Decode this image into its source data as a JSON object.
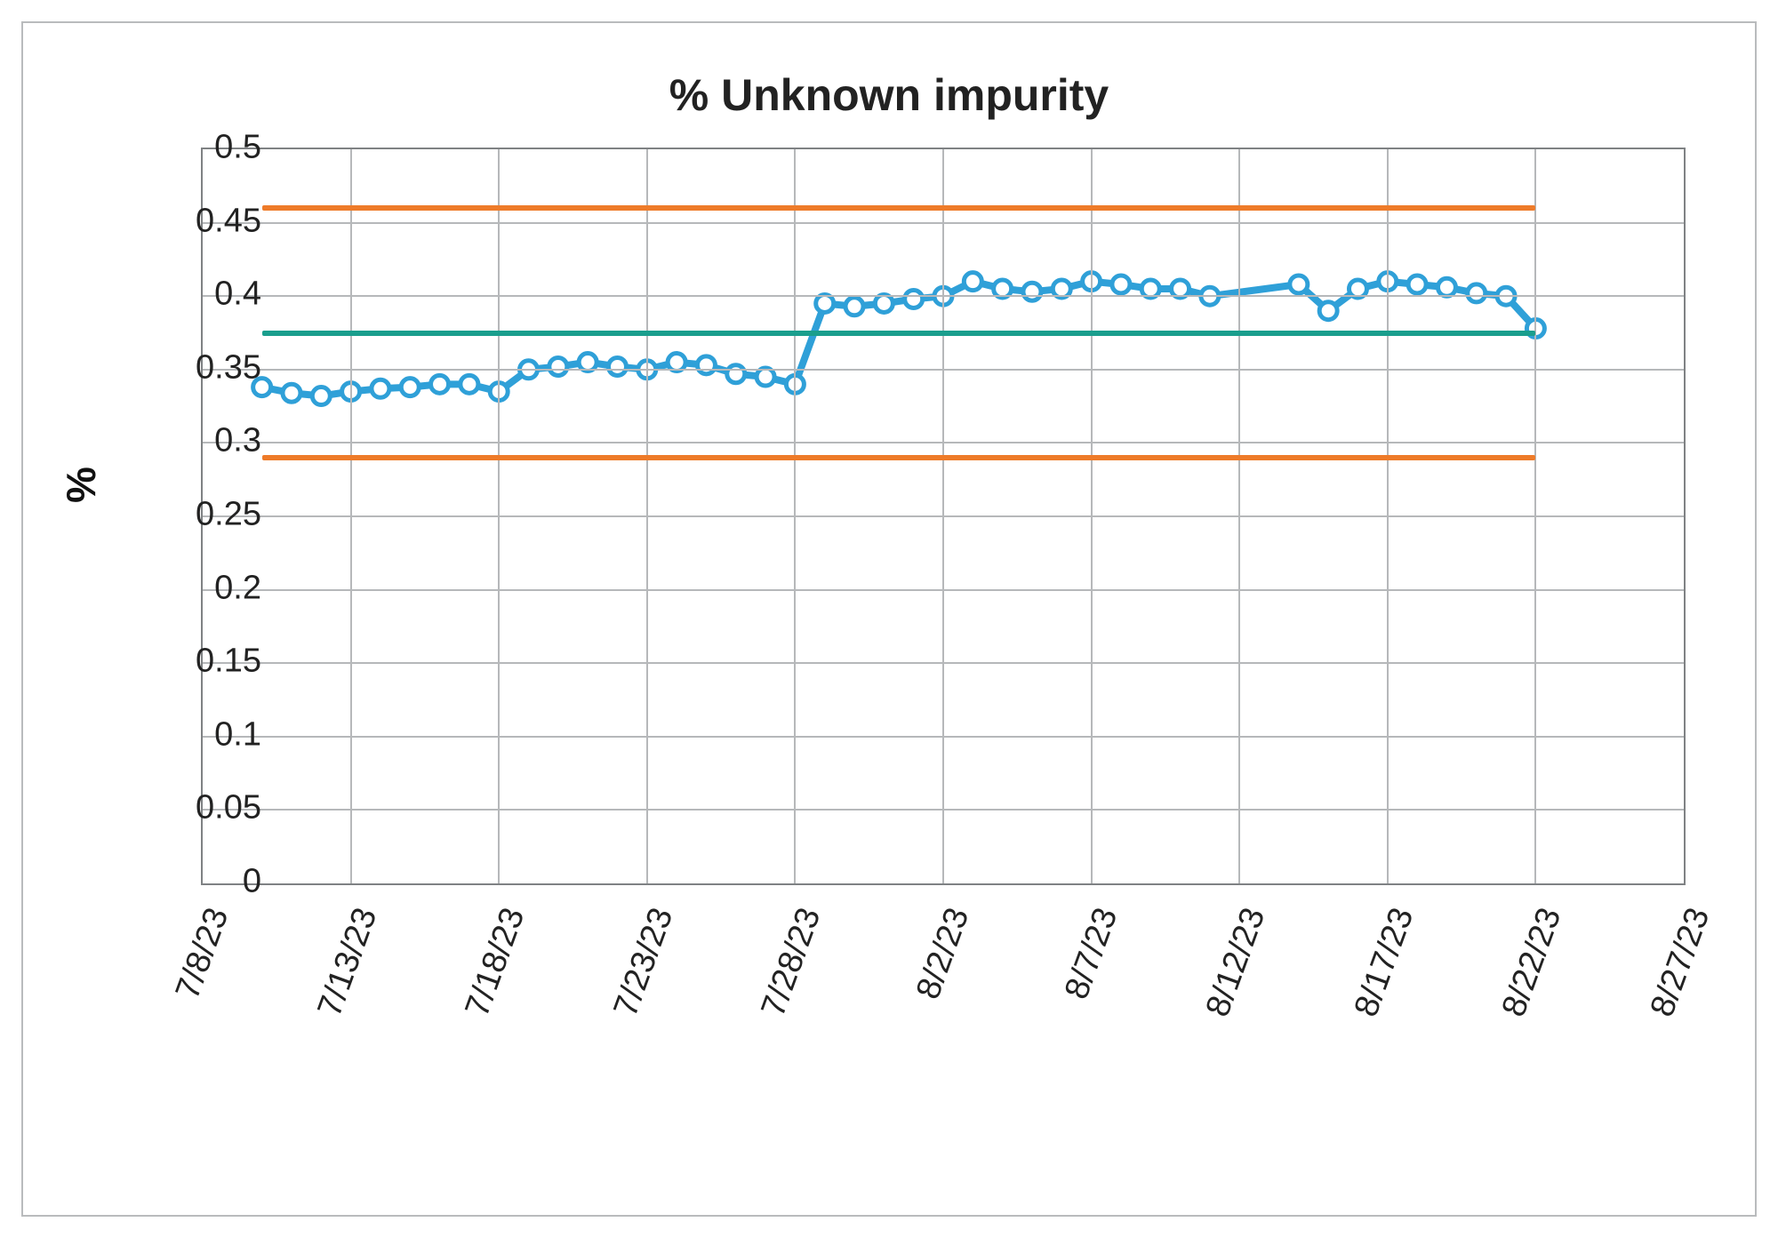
{
  "chart_data": {
    "type": "line",
    "title": "% Unknown impurity",
    "ylabel": "%",
    "xlabel": "",
    "ylim": [
      0,
      0.5
    ],
    "y_ticks": [
      0,
      0.05,
      0.1,
      0.15,
      0.2,
      0.25,
      0.3,
      0.35,
      0.4,
      0.45,
      0.5
    ],
    "x_ticks": [
      "7/8/23",
      "7/13/23",
      "7/18/23",
      "7/23/23",
      "7/28/23",
      "8/2/23",
      "8/7/23",
      "8/12/23",
      "8/17/23",
      "8/22/23",
      "8/27/23"
    ],
    "x_range_days": 50,
    "x_start": "7/8/23",
    "reference_lines": {
      "upper_orange": 0.46,
      "mean_green": 0.375,
      "lower_orange": 0.29
    },
    "reference_x_span_days": [
      2,
      45
    ],
    "series": [
      {
        "name": "% Unknown impurity",
        "color": "#2fa0d8",
        "points": [
          {
            "day_offset": 2,
            "value": 0.338
          },
          {
            "day_offset": 3,
            "value": 0.334
          },
          {
            "day_offset": 4,
            "value": 0.332
          },
          {
            "day_offset": 5,
            "value": 0.335
          },
          {
            "day_offset": 6,
            "value": 0.337
          },
          {
            "day_offset": 7,
            "value": 0.338
          },
          {
            "day_offset": 8,
            "value": 0.34
          },
          {
            "day_offset": 9,
            "value": 0.34
          },
          {
            "day_offset": 10,
            "value": 0.335
          },
          {
            "day_offset": 11,
            "value": 0.35
          },
          {
            "day_offset": 12,
            "value": 0.352
          },
          {
            "day_offset": 13,
            "value": 0.355
          },
          {
            "day_offset": 14,
            "value": 0.352
          },
          {
            "day_offset": 15,
            "value": 0.35
          },
          {
            "day_offset": 16,
            "value": 0.355
          },
          {
            "day_offset": 17,
            "value": 0.353
          },
          {
            "day_offset": 18,
            "value": 0.347
          },
          {
            "day_offset": 19,
            "value": 0.345
          },
          {
            "day_offset": 20,
            "value": 0.34
          },
          {
            "day_offset": 21,
            "value": 0.395
          },
          {
            "day_offset": 22,
            "value": 0.393
          },
          {
            "day_offset": 23,
            "value": 0.395
          },
          {
            "day_offset": 24,
            "value": 0.398
          },
          {
            "day_offset": 25,
            "value": 0.4
          },
          {
            "day_offset": 26,
            "value": 0.41
          },
          {
            "day_offset": 27,
            "value": 0.405
          },
          {
            "day_offset": 28,
            "value": 0.403
          },
          {
            "day_offset": 29,
            "value": 0.405
          },
          {
            "day_offset": 30,
            "value": 0.41
          },
          {
            "day_offset": 31,
            "value": 0.408
          },
          {
            "day_offset": 32,
            "value": 0.405
          },
          {
            "day_offset": 33,
            "value": 0.405
          },
          {
            "day_offset": 34,
            "value": 0.4
          },
          {
            "day_offset": 37,
            "value": 0.408
          },
          {
            "day_offset": 38,
            "value": 0.39
          },
          {
            "day_offset": 39,
            "value": 0.405
          },
          {
            "day_offset": 40,
            "value": 0.41
          },
          {
            "day_offset": 41,
            "value": 0.408
          },
          {
            "day_offset": 42,
            "value": 0.406
          },
          {
            "day_offset": 43,
            "value": 0.402
          },
          {
            "day_offset": 44,
            "value": 0.4
          },
          {
            "day_offset": 45,
            "value": 0.378
          }
        ]
      }
    ]
  },
  "colors": {
    "orange": "#ee7b29",
    "green": "#1a9e8d",
    "blue": "#2fa0d8",
    "grid": "#b6b8ba"
  }
}
